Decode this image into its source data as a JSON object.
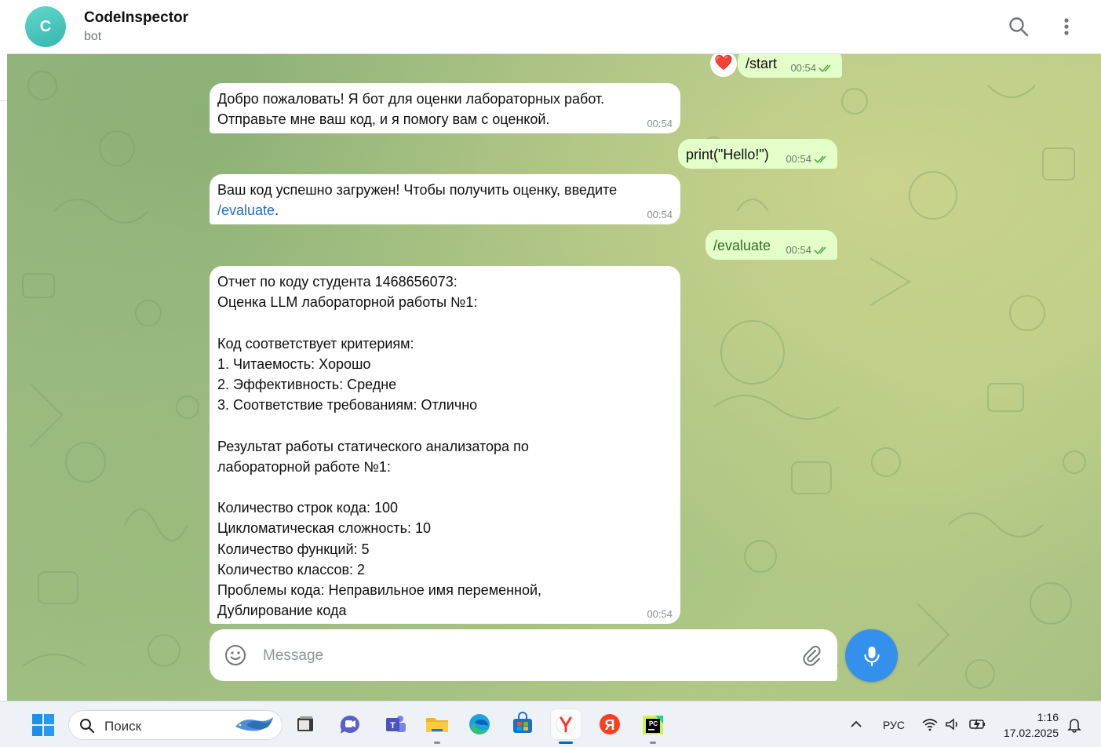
{
  "header": {
    "avatar_letter": "C",
    "chat_name": "CodeInspector",
    "chat_status": "bot"
  },
  "messages": [
    {
      "id": "m1",
      "direction": "out",
      "text": "/start",
      "time": "00:54",
      "reaction": "❤️"
    },
    {
      "id": "m2",
      "direction": "in",
      "text": "Добро пожаловать! Я бот для оценки лабораторных работ. Отправьте мне ваш код, и я помогу вам с оценкой.",
      "time": "00:54"
    },
    {
      "id": "m3",
      "direction": "out",
      "text": "print(\"Hello!\")",
      "time": "00:54"
    },
    {
      "id": "m4",
      "direction": "in",
      "text_before": "Ваш код успешно загружен! Чтобы получить оценку, введите",
      "link": "/evaluate",
      "text_after": ".",
      "time": "00:54"
    },
    {
      "id": "m5",
      "direction": "out",
      "text": "/evaluate",
      "time": "00:54"
    },
    {
      "id": "m6",
      "direction": "in",
      "text": "Отчет по коду студента 1468656073:\nОценка LLM лабораторной работы №1:\n\nКод соответствует критериям:\n1. Читаемость: Хорошо\n2. Эффективность: Средне\n3. Соответствие требованиям: Отлично\n\nРезультат работы статического анализатора по лабораторной работе №1:\n\nКоличество строк кода: 100\nЦикломатическая сложность: 10\nКоличество функций: 5\nКоличество классов: 2\nПроблемы кода: Неправильное имя переменной, Дублирование кода",
      "time": "00:54"
    }
  ],
  "composer": {
    "placeholder": "Message"
  },
  "colors": {
    "outgoing_bubble": "#e3fec8",
    "incoming_bubble": "#ffffff",
    "accent": "#3390ec",
    "link": "#1e6fbf"
  },
  "taskbar": {
    "search_label": "Поиск",
    "apps": [
      "windows-start",
      "search",
      "file-explorer-gray",
      "video-chat",
      "teams",
      "file-explorer",
      "edge",
      "store",
      "yandex-browser",
      "yandex",
      "pycharm"
    ],
    "language": "РУС",
    "time": "1:16",
    "date": "17.02.2025"
  }
}
